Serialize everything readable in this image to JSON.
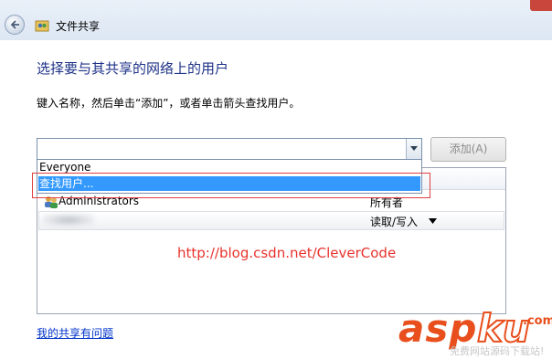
{
  "window": {
    "title": "文件共享"
  },
  "main": {
    "heading": "选择要与其共享的网络上的用户",
    "instruction": "键入名称，然后单击“添加”，或者单击箭头查找用户。",
    "combo_value": "",
    "add_button": "添加(A)",
    "dropdown": {
      "items": [
        "Everyone",
        "查找用户..."
      ],
      "selected": "查找用户..."
    },
    "list": {
      "rows": [
        {
          "name": "Administrators",
          "permission": "所有者"
        },
        {
          "name": "",
          "permission": "读取/写入"
        }
      ]
    },
    "watermark_url": "http://blog.csdn.net/CleverCode",
    "help_link": "我的共享有问题"
  },
  "logo": {
    "asp": "asp",
    "ku": "ku",
    "com": ".com",
    "subtitle": "免费网站源码下载站!"
  },
  "icons": [
    "back-arrow-icon",
    "users-icon",
    "chevron-down-icon"
  ],
  "colors": {
    "heading": "#1e3287",
    "selection": "#3399ff",
    "watermark": "#e8322d",
    "link": "#0033cc",
    "logo": "#e84f1c"
  }
}
